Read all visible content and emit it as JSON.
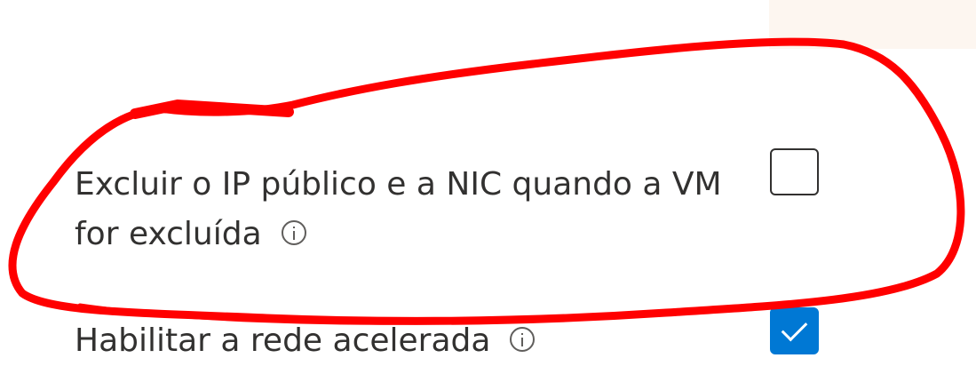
{
  "settings": [
    {
      "label_line1": "Excluir o IP público e a NIC quando a VM",
      "label_line2": "for excluída",
      "checked": false,
      "icon": "info-icon"
    },
    {
      "label_line1": "Habilitar a rede acelerada",
      "checked": true,
      "icon": "info-icon"
    }
  ],
  "colors": {
    "checkbox_checked": "#0078d4",
    "annotation_stroke": "#ff0000",
    "text": "#323130"
  }
}
